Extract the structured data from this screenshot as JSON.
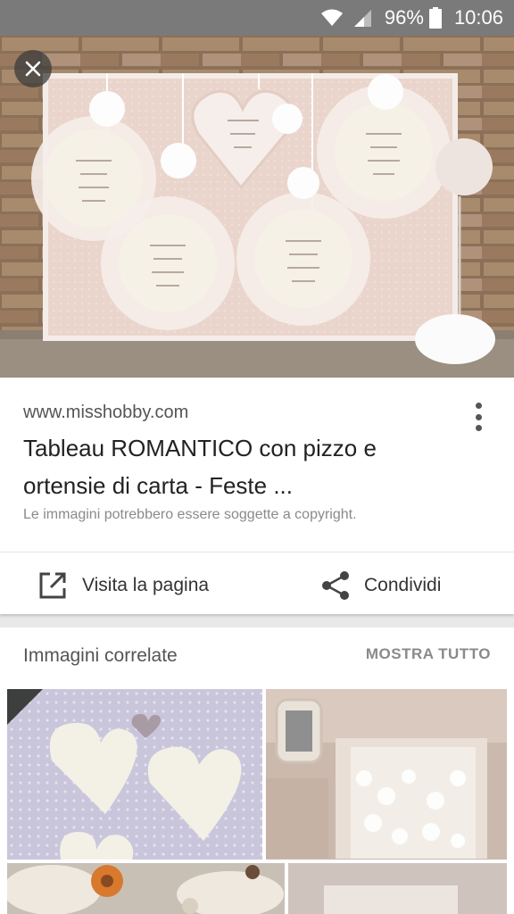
{
  "status_bar": {
    "battery_percent": "96%",
    "time": "10:06"
  },
  "result": {
    "source": "www.misshobby.com",
    "title": "Tableau ROMANTICO con pizzo e ortensie di carta - Feste ...",
    "copyright": "Le immagini potrebbero essere soggette a copyright.",
    "visit_label": "Visita la pagina",
    "share_label": "Condividi"
  },
  "related": {
    "title": "Immagini correlate",
    "show_all": "MOSTRA TUTTO"
  }
}
